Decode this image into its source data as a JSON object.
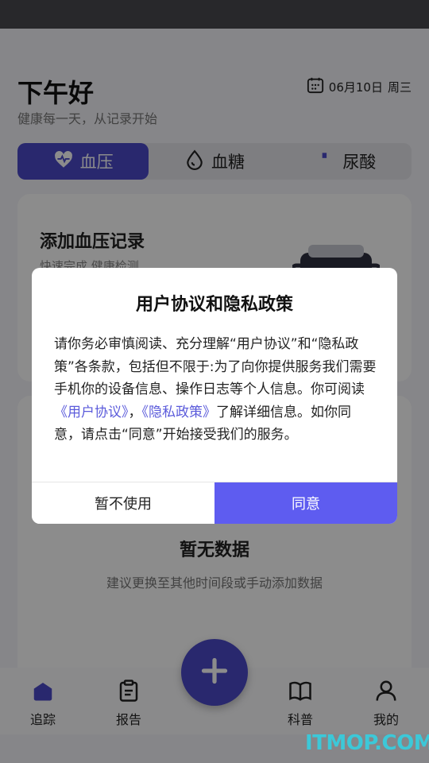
{
  "header": {
    "greeting": "下午好",
    "subtitle": "健康每一天，从记录开始",
    "date": "06月10日",
    "weekday": "周三"
  },
  "tabs": [
    {
      "label": "血压",
      "icon": "heart-pulse-icon",
      "active": true
    },
    {
      "label": "血糖",
      "icon": "drop-icon",
      "active": false
    },
    {
      "label": "尿酸",
      "icon": "uric-icon",
      "active": false
    }
  ],
  "add_card": {
    "title": "添加血压记录",
    "subtitle": "快速完成 健康检测"
  },
  "empty_state": {
    "title": "暂无数据",
    "subtitle": "建议更换至其他时间段或手动添加数据"
  },
  "nav": {
    "track": "追踪",
    "report": "报告",
    "science": "科普",
    "mine": "我的"
  },
  "dialog": {
    "title": "用户协议和隐私政策",
    "body_part1": "请你务必审慎阅读、充分理解“用户协议”和“隐私政策”各条款，包括但不限于:为了向你提供服务我们需要手机你的设备信息、操作日志等个人信息。你可阅读",
    "link_user_agreement": "《用户协议》",
    "separator": "，",
    "link_privacy_policy": "《隐私政策》",
    "body_part2": "了解详细信息。如你同意，请点击“同意”开始接受我们的服务。",
    "decline_label": "暂不使用",
    "agree_label": "同意"
  },
  "watermark": "ITMOP.COM",
  "colors": {
    "accent": "#4b49c9",
    "agree_button": "#5e5cf0",
    "link": "#5b5bdb"
  }
}
